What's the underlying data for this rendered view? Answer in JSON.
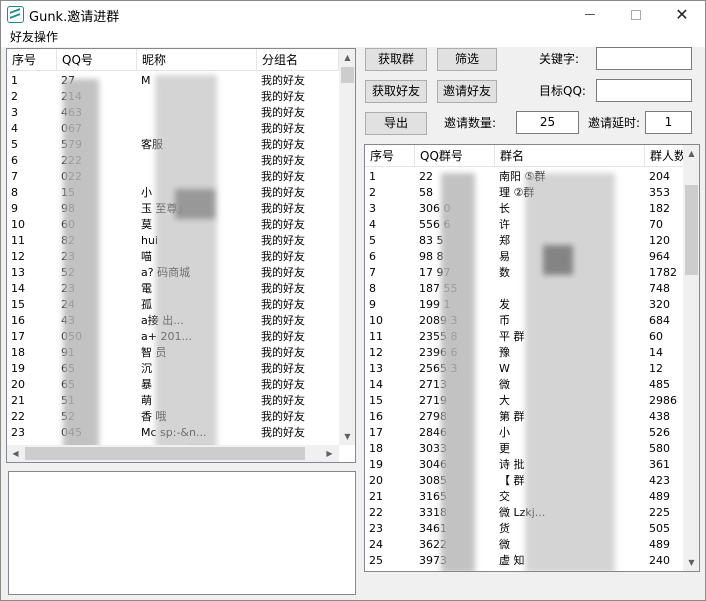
{
  "window": {
    "title": "Gunk.邀请进群"
  },
  "menu": {
    "friend_ops": "好友操作"
  },
  "friends": {
    "headers": [
      "序号",
      "QQ号",
      "昵称",
      "分组名"
    ],
    "rows": [
      [
        "1",
        "27",
        "M",
        "我的好友"
      ],
      [
        "2",
        "214",
        "",
        "我的好友"
      ],
      [
        "3",
        "463",
        "",
        "我的好友"
      ],
      [
        "4",
        "067",
        "",
        "我的好友"
      ],
      [
        "5",
        "579",
        "客服",
        "我的好友"
      ],
      [
        "6",
        "222",
        "",
        "我的好友"
      ],
      [
        "7",
        "022",
        "",
        "我的好友"
      ],
      [
        "8",
        "15",
        "小",
        "我的好友"
      ],
      [
        "9",
        "98",
        "玉 至尊」",
        "我的好友"
      ],
      [
        "10",
        "60",
        "莫",
        "我的好友"
      ],
      [
        "11",
        "82",
        "hui",
        "我的好友"
      ],
      [
        "12",
        "23",
        "喵",
        "我的好友"
      ],
      [
        "13",
        "52",
        "a? 码商城",
        "我的好友"
      ],
      [
        "14",
        "23",
        "電",
        "我的好友"
      ],
      [
        "15",
        "24",
        "孤",
        "我的好友"
      ],
      [
        "16",
        "43",
        "a接 出...",
        "我的好友"
      ],
      [
        "17",
        "050",
        "a+ 201...",
        "我的好友"
      ],
      [
        "18",
        "91",
        "智 员",
        "我的好友"
      ],
      [
        "19",
        "65",
        "沉",
        "我的好友"
      ],
      [
        "20",
        "65",
        "暴",
        "我的好友"
      ],
      [
        "21",
        "51",
        "萌",
        "我的好友"
      ],
      [
        "22",
        "52",
        "香 哦",
        "我的好友"
      ],
      [
        "23",
        "045",
        "Mc sp:-&n...",
        "我的好友"
      ]
    ]
  },
  "controls": {
    "get_groups": "获取群",
    "filter": "筛选",
    "get_friends": "获取好友",
    "invite_friends": "邀请好友",
    "export": "导出",
    "keyword_label": "关键字:",
    "keyword_value": "",
    "target_qq_label": "目标QQ:",
    "target_qq_value": "",
    "invite_count_label": "邀请数量:",
    "invite_count_value": "25",
    "invite_delay_label": "邀请延时:",
    "invite_delay_value": "1"
  },
  "groups": {
    "headers": [
      "序号",
      "QQ群号",
      "群名",
      "群人数"
    ],
    "rows": [
      [
        "1",
        "22",
        "南阳 ⑤群",
        "204"
      ],
      [
        "2",
        "58",
        "理 ②群",
        "353"
      ],
      [
        "3",
        "306 0",
        "长",
        "182"
      ],
      [
        "4",
        "556 6",
        "许",
        "70"
      ],
      [
        "5",
        "83 5",
        "郑",
        "120"
      ],
      [
        "6",
        "98 8",
        "易",
        "964"
      ],
      [
        "7",
        "17 97",
        "数",
        "1782"
      ],
      [
        "8",
        "187 55",
        "",
        "748"
      ],
      [
        "9",
        "199 1",
        "发",
        "320"
      ],
      [
        "10",
        "2089 3",
        "币",
        "684"
      ],
      [
        "11",
        "2355 8",
        "平 群",
        "60"
      ],
      [
        "12",
        "2396 6",
        "豫",
        "14"
      ],
      [
        "13",
        "2565 3",
        "W",
        "12"
      ],
      [
        "14",
        "2713",
        "微",
        "485"
      ],
      [
        "15",
        "2719",
        "大",
        "2986"
      ],
      [
        "16",
        "2798",
        "第 群",
        "438"
      ],
      [
        "17",
        "2846",
        "小",
        "526"
      ],
      [
        "18",
        "3033",
        "更",
        "580"
      ],
      [
        "19",
        "3046",
        "诗 批",
        "361"
      ],
      [
        "20",
        "3085",
        "【 群",
        "423"
      ],
      [
        "21",
        "3165",
        "交",
        "489"
      ],
      [
        "22",
        "3318",
        "微 Lzkj...",
        "225"
      ],
      [
        "23",
        "3461",
        "货",
        "505"
      ],
      [
        "24",
        "3622",
        "微",
        "489"
      ],
      [
        "25",
        "3973",
        "虚 知",
        "240"
      ]
    ]
  },
  "colors": {
    "teal_icon": "#1a8b8b",
    "window_bg": "#f0f0f0",
    "border": "#828790"
  }
}
